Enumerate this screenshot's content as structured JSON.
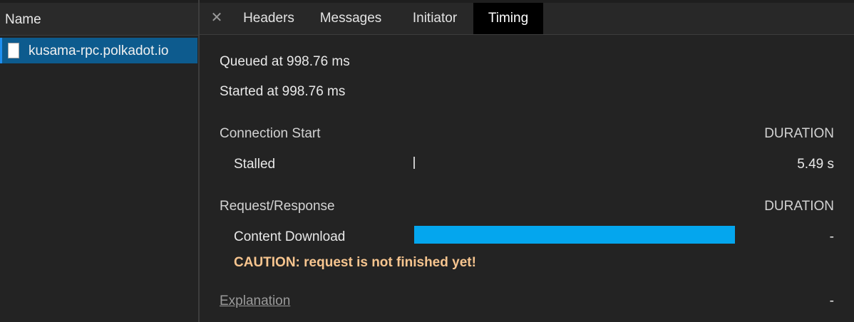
{
  "sidebar": {
    "header_label": "Name",
    "file": {
      "label": "kusama-rpc.polkadot.io",
      "icon": "document-icon"
    }
  },
  "tabs": {
    "close_glyph": "✕",
    "items": [
      "Headers",
      "Messages",
      "Initiator",
      "Timing"
    ],
    "active": "Timing"
  },
  "timing": {
    "queued": "Queued at 998.76 ms",
    "started": "Started at 998.76 ms",
    "connection_section": "Connection Start",
    "connection_duration_header": "DURATION",
    "stalled_label": "Stalled",
    "stalled_value": "5.49 s",
    "request_section": "Request/Response",
    "request_duration_header": "DURATION",
    "download_label": "Content Download",
    "download_value": "-",
    "caution": "CAUTION: request is not finished yet!",
    "explanation_label": "Explanation",
    "explanation_value": "-"
  },
  "colors": {
    "selected_row": "#0d5b8e",
    "download_bar": "#04a6ee",
    "caution": "#f7c58f"
  }
}
